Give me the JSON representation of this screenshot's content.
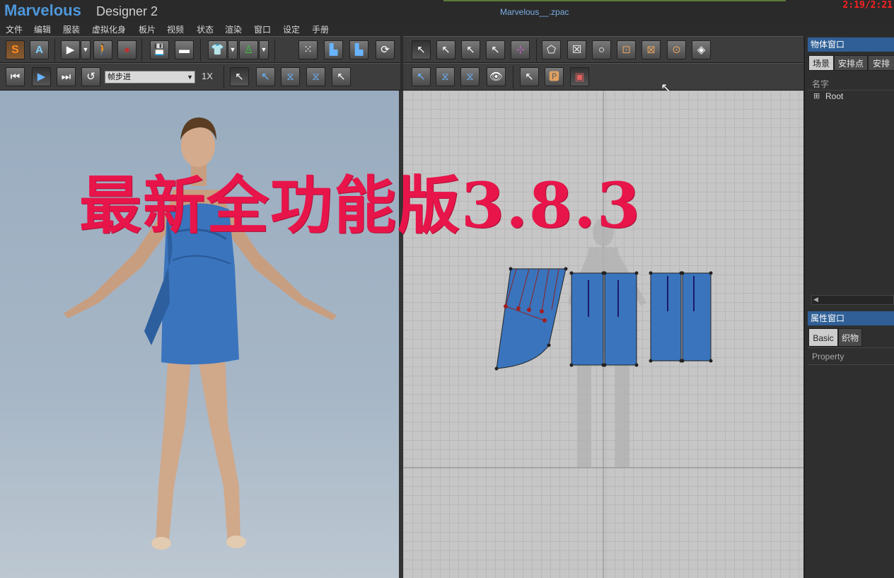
{
  "window": {
    "brand_main": "Marvelous",
    "brand_sub": "Designer 2",
    "file_name": "Marvelous__.zpac",
    "clock": "2:19/2:21"
  },
  "menu": [
    "文件",
    "编辑",
    "服装",
    "虚拟化身",
    "板片",
    "视频",
    "状态",
    "渲染",
    "窗口",
    "设定",
    "手册"
  ],
  "toolbar": {
    "mode_s": "S",
    "mode_a": "A",
    "playback_mode": "帧步进",
    "speed": "1X"
  },
  "watermark": "最新全功能版3.8.3",
  "object_window": {
    "title": "物体窗口",
    "tabs": [
      "场景",
      "安排点",
      "安排"
    ],
    "column_header": "名字",
    "tree_root": "Root"
  },
  "property_window": {
    "title": "属性窗口",
    "tabs": [
      "Basic",
      "织物"
    ],
    "row_label": "Property"
  },
  "colors": {
    "accent_blue": "#2f5f96",
    "dress_blue": "#3a74bd",
    "watermark_red": "#e8154a",
    "clock_red": "#ff2020"
  }
}
